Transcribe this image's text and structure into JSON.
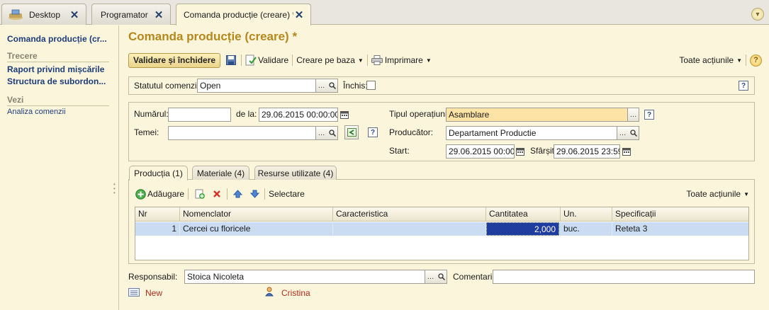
{
  "tabs": [
    {
      "label": "Desktop"
    },
    {
      "label": "Programator"
    },
    {
      "label": "Comanda producție (creare) *"
    }
  ],
  "nav": {
    "title": "Comanda producție (cr...",
    "section_go": "Trecere",
    "links": [
      "Raport privind mișcările",
      "Structura de subordon..."
    ],
    "section_see": "Vezi",
    "see_links": [
      "Analiza comenzii"
    ]
  },
  "form": {
    "title": "Comanda producție (creare) *",
    "toolbar": {
      "save_close": "Validare și închidere",
      "validate": "Validare",
      "create_based": "Creare pe baza",
      "print": "Imprimare",
      "all_actions": "Toate acțiunile"
    },
    "status": {
      "label": "Statutul comenzii:",
      "value": "Open",
      "closed_label": "Închis:",
      "closed": false
    },
    "header": {
      "number_label": "Numărul:",
      "number_value": "",
      "date_label": "de la:",
      "date_value": "29.06.2015 00:00:00",
      "basis_label": "Temei:",
      "basis_value": "",
      "operation_label": "Tipul operațiunii:",
      "operation_value": "Asamblare",
      "producer_label": "Producător:",
      "producer_value": "Departament Productie",
      "start_label": "Start:",
      "start_value": "29.06.2015 00:00:0",
      "end_label": "Sfârșit:",
      "end_value": "29.06.2015 23:59:5"
    },
    "subtabs": [
      "Producția (1)",
      "Materiale (4)",
      "Resurse utilizate (4)"
    ],
    "table_toolbar": {
      "add": "Adăugare",
      "select": "Selectare",
      "all_actions": "Toate acțiunile"
    },
    "table": {
      "columns": [
        "Nr",
        "Nomenclator",
        "Caracteristica",
        "Cantitatea",
        "Un.",
        "Specificații"
      ],
      "rows": [
        {
          "nr": "1",
          "item": "Cercei cu floricele",
          "characteristic": "",
          "qty": "2,000",
          "unit": "buc.",
          "spec": "Reteta 3"
        }
      ]
    },
    "responsible": {
      "label": "Responsabil:",
      "value": "Stoica Nicoleta"
    },
    "comment": {
      "label": "Comentariu:",
      "value": ""
    },
    "footer": {
      "status": "New",
      "author": "Cristina"
    }
  },
  "colors": {
    "accent": "#b5881c",
    "link": "#1c3d7a",
    "background": "#fbf5dc",
    "highlight": "#fde4a6",
    "selected_row": "#c9dcf1"
  }
}
